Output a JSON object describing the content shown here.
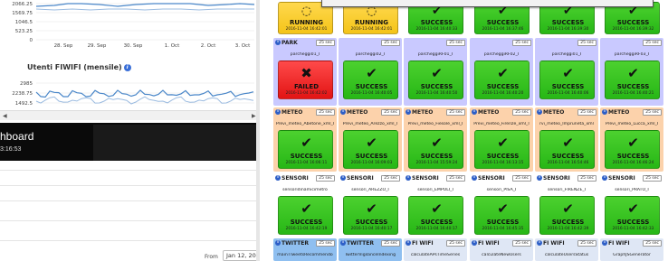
{
  "left": {
    "chart1": {
      "y_ticks": [
        "2066.25",
        "1569.75",
        "1046.5",
        "523.25",
        "0"
      ],
      "x_ticks": [
        "28. Sep",
        "29. Sep",
        "30. Sep",
        "1. Oct",
        "2. Oct",
        "3. Oct"
      ],
      "colors": {
        "line": "#4a87c9",
        "line_light": "#9bbbe0",
        "grid": "#e2e2e2"
      }
    },
    "chart2": {
      "title": "Utenti FIWIFI (mensile)",
      "y_ticks": [
        "2985",
        "2238.75",
        "1492.5"
      ],
      "colors": {
        "line": "#4a87c9",
        "line_light": "#9bbbe0",
        "grid": "#e2e2e2"
      }
    },
    "dashboard": {
      "title": "hboard",
      "time": "3:16:53"
    },
    "filter": {
      "from_label": "From",
      "date_value": "Jan 12, 20"
    }
  },
  "rows": [
    {
      "cells": [
        {
          "name": "",
          "sec": "",
          "job": "",
          "status": "running",
          "status_label": "RUNNING",
          "time": "2016-11-04 16:42:01",
          "icon": "spinner-icon"
        },
        {
          "name": "",
          "sec": "",
          "job": "",
          "status": "running",
          "status_label": "RUNNING",
          "time": "2016-11-04 16:42:01",
          "icon": "spinner-icon"
        },
        {
          "name": "",
          "sec": "",
          "job": "",
          "status": "success",
          "status_label": "SUCCESS",
          "time": "2016-11-04 16:40:33",
          "icon": "check-icon"
        },
        {
          "name": "",
          "sec": "",
          "job": "",
          "status": "success",
          "status_label": "SUCCESS",
          "time": "2016-11-04 16:37:46",
          "icon": "check-icon"
        },
        {
          "name": "",
          "sec": "",
          "job": "",
          "status": "success",
          "status_label": "SUCCESS",
          "time": "2016-11-04 16:39:30",
          "icon": "check-icon"
        },
        {
          "name": "",
          "sec": "",
          "job": "",
          "status": "success",
          "status_label": "SUCCESS",
          "time": "2016-11-04 16:39:32",
          "icon": "check-icon"
        }
      ]
    },
    {
      "color": "#c9c9ff",
      "cells": [
        {
          "name": "PARK",
          "sec": "25 sec",
          "job": "parcheggi01_I",
          "status": "failed",
          "status_label": "FAILED",
          "time": "2016-11-04 16:42:02",
          "icon": "x-icon"
        },
        {
          "name": "",
          "sec": "25 sec",
          "job": "parcheggi02_I",
          "status": "success",
          "status_label": "SUCCESS",
          "time": "2016-11-04 16:40:05",
          "icon": "check-icon"
        },
        {
          "name": "",
          "sec": "25 sec",
          "job": "parcheggiRF01_I",
          "status": "success",
          "status_label": "SUCCESS",
          "time": "2016-11-04 16:40:50",
          "icon": "check-icon"
        },
        {
          "name": "",
          "sec": "25 sec",
          "job": "parcheggiRF02_I",
          "status": "success",
          "status_label": "SUCCESS",
          "time": "2016-11-04 16:40:20",
          "icon": "check-icon"
        },
        {
          "name": "",
          "sec": "25 sec",
          "job": "parcheggi01_I",
          "status": "success",
          "status_label": "SUCCESS",
          "time": "2016-11-04 16:40:06",
          "icon": "check-icon"
        },
        {
          "name": "",
          "sec": "25 sec",
          "job": "parcheggiRF03_I",
          "status": "success",
          "status_label": "SUCCESS",
          "time": "2016-11-04 16:40:21",
          "icon": "check-icon"
        }
      ]
    },
    {
      "color": "#fcd2ab",
      "cells": [
        {
          "name": "METEO",
          "sec": "25 sec",
          "job": "Previ_meteo_Abetone_xml_I",
          "status": "success",
          "status_label": "SUCCESS",
          "time": "2016-11-04 16:06:11",
          "icon": "check-icon"
        },
        {
          "name": "METEO",
          "sec": "25 sec",
          "job": "Previ_meteo_Arezzo_xml_I",
          "status": "success",
          "status_label": "SUCCESS",
          "time": "2016-11-04 16:09:03",
          "icon": "check-icon"
        },
        {
          "name": "METEO",
          "sec": "25 sec",
          "job": "Previ_meteo_Fiesole_xml_I",
          "status": "success",
          "status_label": "SUCCESS",
          "time": "2016-11-04 15:59:24",
          "icon": "check-icon"
        },
        {
          "name": "METEO",
          "sec": "25 sec",
          "job": "Previ_meteo_Firenze_xml_I",
          "status": "success",
          "status_label": "SUCCESS",
          "time": "2016-11-04 16:13:15",
          "icon": "check-icon"
        },
        {
          "name": "METEO",
          "sec": "25 sec",
          "job": "rvi_meteo_Impruneta_xml",
          "status": "success",
          "status_label": "SUCCESS",
          "time": "2016-11-04 16:54:46",
          "icon": "check-icon"
        },
        {
          "name": "METEO",
          "sec": "25 sec",
          "job": "Previ_meteo_Lucca_xml_I",
          "status": "success",
          "status_label": "SUCCESS",
          "time": "2016-11-04 16:46:24",
          "icon": "check-icon"
        }
      ]
    },
    {
      "color": "#ffffff",
      "cells": [
        {
          "name": "SENSORI",
          "sec": "25 sec",
          "job": "sensoridinamicimetro",
          "status": "success",
          "status_label": "SUCCESS",
          "time": "2016-11-04 16:42:19",
          "icon": "check-icon"
        },
        {
          "name": "SENSORI",
          "sec": "25 sec",
          "job": "sensori_AREZZO_I",
          "status": "success",
          "status_label": "SUCCESS",
          "time": "2016-11-04 16:40:17",
          "icon": "check-icon"
        },
        {
          "name": "SENSORI",
          "sec": "25 sec",
          "job": "sensori_EMPOLI_I",
          "status": "success",
          "status_label": "SUCCESS",
          "time": "2016-11-04 16:40:17",
          "icon": "check-icon"
        },
        {
          "name": "SENSORI",
          "sec": "25 sec",
          "job": "sensori_PISA_I",
          "status": "success",
          "status_label": "SUCCESS",
          "time": "2016-11-04 16:45:35",
          "icon": "check-icon"
        },
        {
          "name": "SENSORI",
          "sec": "25 sec",
          "job": "sensori_FIRENZE_I",
          "status": "success",
          "status_label": "SUCCESS",
          "time": "2016-11-04 16:42:39",
          "icon": "check-icon"
        },
        {
          "name": "SENSORI",
          "sec": "25 sec",
          "job": "sensori_PRATO_I",
          "status": "success",
          "status_label": "SUCCESS",
          "time": "2016-11-04 16:42:33",
          "icon": "check-icon"
        }
      ]
    },
    {
      "cells": [
        {
          "name": "TWITTER",
          "sec": "25 sec",
          "job": "mainTTweetsRecommendo",
          "color": "#8fbff0"
        },
        {
          "name": "TWITTER",
          "sec": "25 sec",
          "job": "TwitterVigilanceIndexing",
          "color": "#8fbff0"
        },
        {
          "name": "FI WIFI",
          "sec": "25 sec",
          "job": "calculateAPsTimeSeries",
          "color": "#dfe7f5"
        },
        {
          "name": "FI WIFI",
          "sec": "25 sec",
          "job": "calculateNewUsers",
          "color": "#dfe7f5"
        },
        {
          "name": "FI WIFI",
          "sec": "25 sec",
          "job": "calculateUsersStatus",
          "color": "#dfe7f5"
        },
        {
          "name": "FI WIFI",
          "sec": "25 sec",
          "job": "GraphJSGenerator",
          "color": "#dfe7f5"
        }
      ]
    }
  ]
}
